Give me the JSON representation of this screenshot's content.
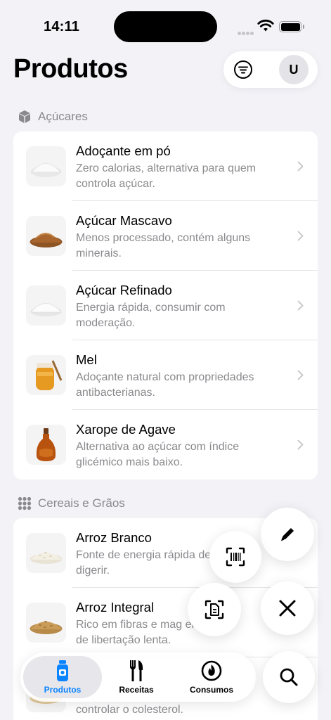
{
  "status_bar": {
    "time": "14:11"
  },
  "header": {
    "title": "Produtos",
    "avatar_initial": "U"
  },
  "sections": [
    {
      "title": "Açúcares",
      "icon": "cube-icon",
      "items": [
        {
          "name": "Adoçante em pó",
          "desc": "Zero calorias, alternativa para quem controla açúcar.",
          "thumb": "white-powder"
        },
        {
          "name": "Açúcar Mascavo",
          "desc": "Menos processado, contém alguns minerais.",
          "thumb": "brown-sugar"
        },
        {
          "name": "Açúcar Refinado",
          "desc": "Energia rápida, consumir com moderação.",
          "thumb": "white-sugar"
        },
        {
          "name": "Mel",
          "desc": "Adoçante natural com propriedades antibacterianas.",
          "thumb": "honey-jar"
        },
        {
          "name": "Xarope de Agave",
          "desc": "Alternativa ao açúcar com índice glicémico mais baixo.",
          "thumb": "syrup-bottle"
        }
      ]
    },
    {
      "title": "Cereais e Grãos",
      "icon": "grid-dots-icon",
      "items": [
        {
          "name": "Arroz Branco",
          "desc": "Fonte de energia rápida de digerir.",
          "thumb": "white-rice"
        },
        {
          "name": "Arroz Integral",
          "desc": "Rico em fibras e mag energia de libertação lenta.",
          "thumb": "brown-rice"
        },
        {
          "name": "",
          "desc": "controlar o colesterol.",
          "thumb": "oats"
        }
      ]
    }
  ],
  "tabs": [
    {
      "label": "Produtos",
      "icon": "bottle-icon",
      "active": true
    },
    {
      "label": "Receitas",
      "icon": "fork-knife-icon",
      "active": false
    },
    {
      "label": "Consumos",
      "icon": "flame-gauge-icon",
      "active": false
    }
  ],
  "colors": {
    "accent": "#0a84ff",
    "background": "#f2f2f7",
    "secondary_text": "#8a8a8e"
  }
}
